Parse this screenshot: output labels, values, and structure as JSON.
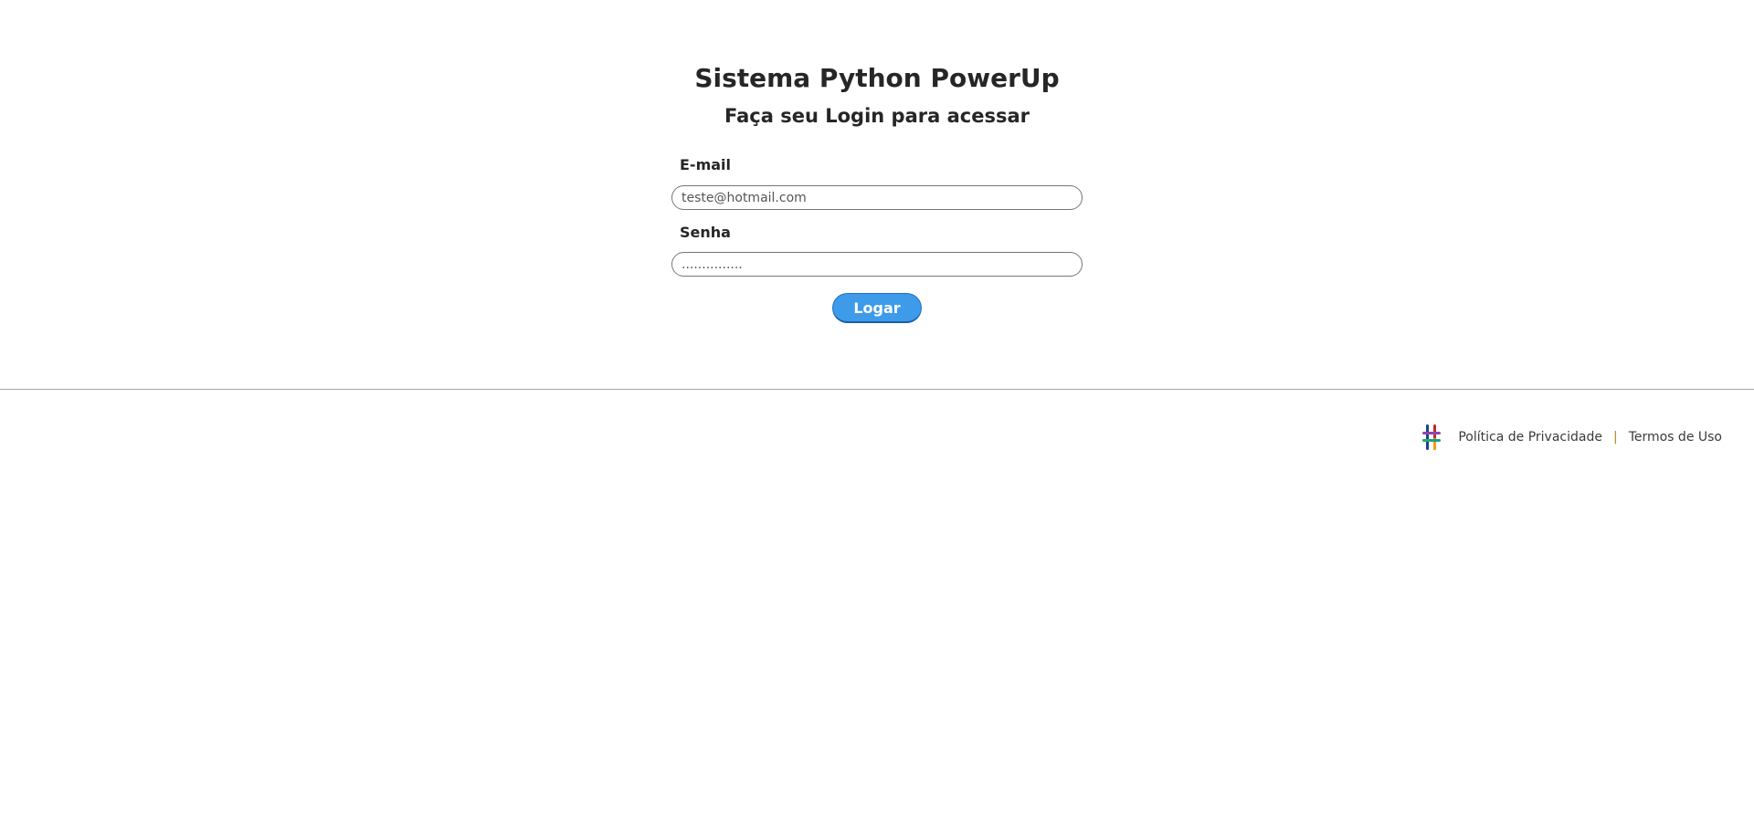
{
  "header": {
    "title": "Sistema Python PowerUp",
    "subtitle": "Faça seu Login para acessar"
  },
  "login_form": {
    "email_label": "E-mail",
    "email_value": "teste@hotmail.com",
    "password_label": "Senha",
    "password_value": "...............",
    "submit_label": "Logar"
  },
  "footer": {
    "logo_icon": "hashtag-logo-icon",
    "privacy_label": "Política de Privacidade",
    "separator": "|",
    "terms_label": "Termos de Uso"
  },
  "colors": {
    "button_bg": "#3d9be9",
    "text": "#262626",
    "separator": "#b38b1d",
    "divider": "#a6a6a6"
  }
}
